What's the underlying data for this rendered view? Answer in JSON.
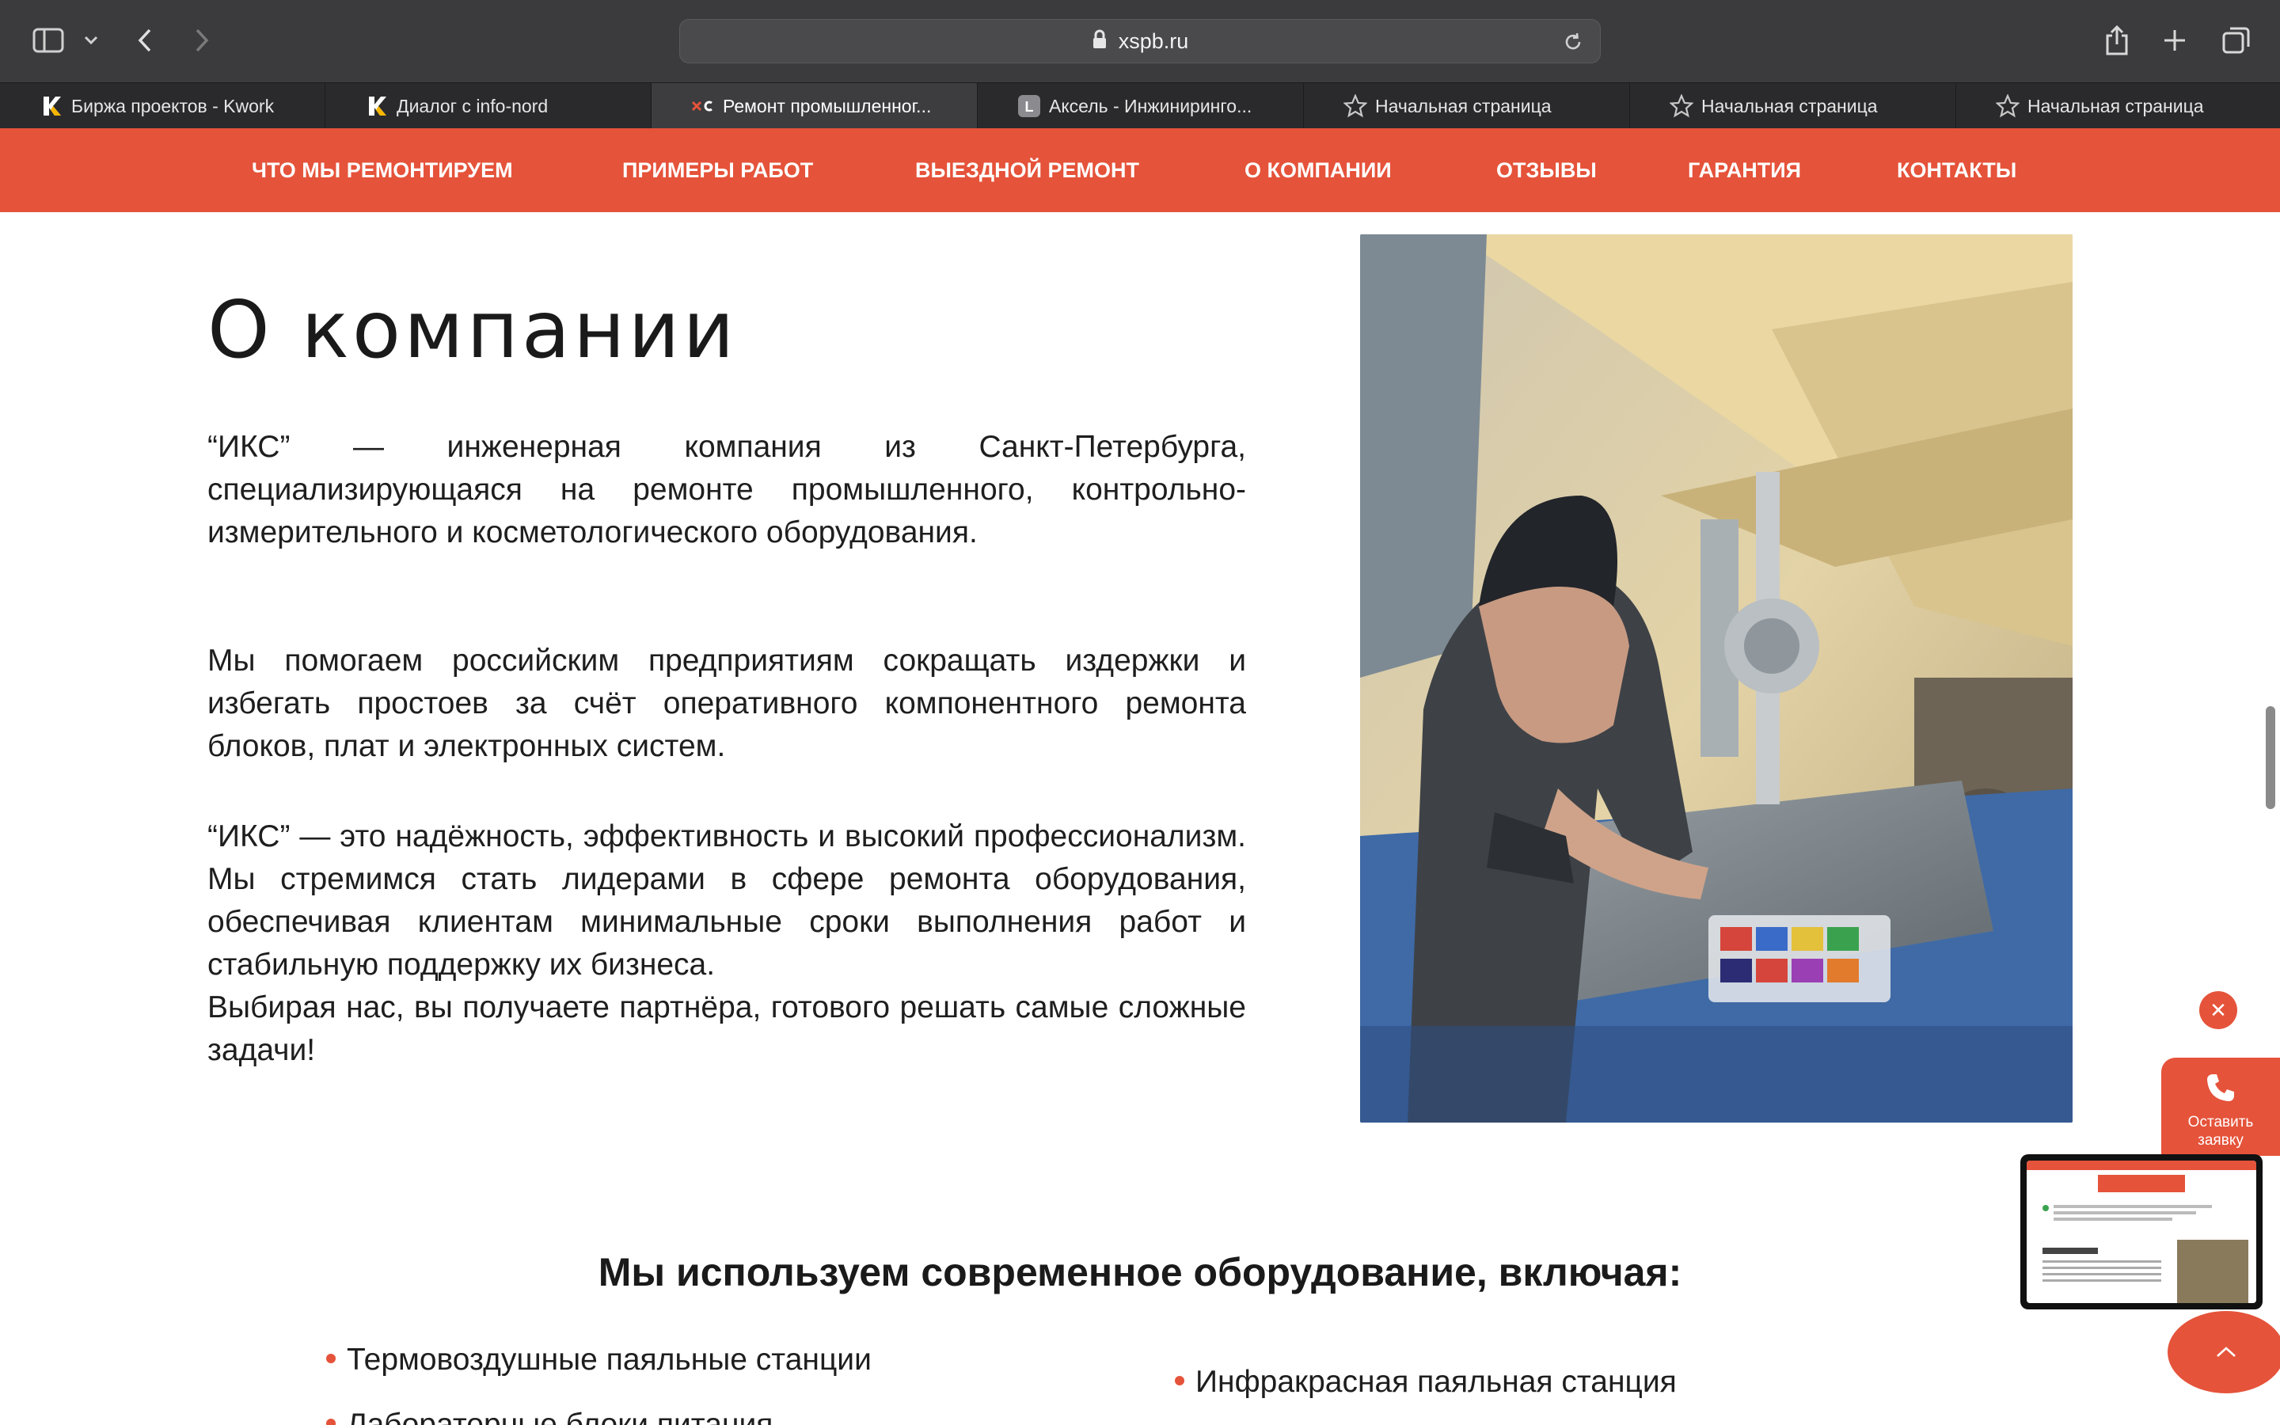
{
  "browser": {
    "url": "xspb.ru",
    "tabs": [
      {
        "label": "Биржа проектов - Kwork",
        "favicon": "kwork-k-icon"
      },
      {
        "label": "Диалог с info-nord",
        "favicon": "kwork-k-icon"
      },
      {
        "label": "Ремонт промышленног...",
        "favicon": "xspb-logo-icon",
        "active": true
      },
      {
        "label": "Аксель - Инжиниринго...",
        "favicon": "letter-l-icon"
      },
      {
        "label": "Начальная страница",
        "favicon": "star-icon"
      },
      {
        "label": "Начальная страница",
        "favicon": "star-icon"
      },
      {
        "label": "Начальная страница",
        "favicon": "star-icon"
      }
    ]
  },
  "nav": {
    "items": [
      "ЧТО МЫ РЕМОНТИРУЕМ",
      "ПРИМЕРЫ РАБОТ",
      "ВЫЕЗДНОЙ РЕМОНТ",
      "О КОМПАНИИ",
      "ОТЗЫВЫ",
      "ГАРАНТИЯ",
      "КОНТАКТЫ"
    ]
  },
  "about": {
    "title": "О компании",
    "p1": "“ИКС” — инженерная компания из Санкт-Петербурга, специализирующаяся на ремонте промышленного, контрольно-измерительного и косметологического оборудования.",
    "p2": "Мы помогаем российским предприятиям сокращать издержки и избегать простоев за счёт оперативного компонентного ремонта блоков, плат и электронных систем.",
    "p3": "“ИКС” — это надёжность, эффективность и высокий профессионализм. Мы стремимся стать лидерами в сфере ремонта оборудования, обеспечивая клиентам минимальные сроки выполнения работ и стабильную поддержку их бизнеса.",
    "p4": "Выбирая нас, вы получаете партнёра, готового решать самые сложные задачи!"
  },
  "equipment": {
    "title_pre": "Мы используем ",
    "title_bold": "современное оборудование",
    "title_post": ", включая:",
    "items": [
      "Термовоздушные паяльные станции",
      "Инфракрасная паяльная станция",
      "Лабораторные блоки питания"
    ]
  },
  "widgets": {
    "callback_line1": "Оставить",
    "callback_line2": "заявку",
    "close_symbol": "✕"
  },
  "colors": {
    "accent": "#e5533a",
    "chrome": "#3b3b3e",
    "tabbar": "#2a2a2c"
  }
}
